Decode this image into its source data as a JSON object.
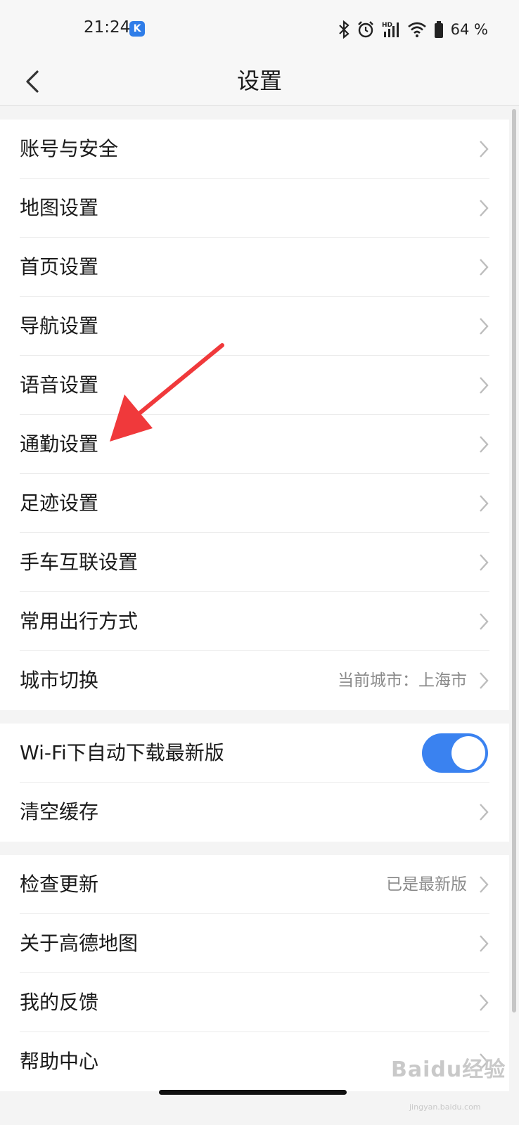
{
  "status_bar": {
    "time": "21:24",
    "app_icon_letter": "K",
    "battery": "64 %",
    "icons": [
      "bluetooth-icon",
      "alarm-icon",
      "hd-signal-icon",
      "wifi-icon",
      "battery-icon"
    ]
  },
  "header": {
    "title": "设置",
    "back_icon": "back-arrow-icon"
  },
  "groups": {
    "main": [
      {
        "label": "账号与安全"
      },
      {
        "label": "地图设置"
      },
      {
        "label": "首页设置"
      },
      {
        "label": "导航设置"
      },
      {
        "label": "语音设置"
      },
      {
        "label": "通勤设置"
      },
      {
        "label": "足迹设置"
      },
      {
        "label": "手车互联设置"
      },
      {
        "label": "常用出行方式"
      },
      {
        "label": "城市切换",
        "value": "当前城市：上海市"
      }
    ],
    "download": [
      {
        "label": "Wi-Fi下自动下载最新版",
        "toggle_on": true
      },
      {
        "label": "清空缓存"
      }
    ],
    "about": [
      {
        "label": "检查更新",
        "value": "已是最新版"
      },
      {
        "label": "关于高德地图"
      },
      {
        "label": "我的反馈"
      },
      {
        "label": "帮助中心"
      }
    ]
  },
  "annotation": {
    "color": "#f0393b",
    "icon": "red-arrow-annotation"
  },
  "watermark": {
    "text": "Baidu经验",
    "sub": "jingyan.baidu.com"
  }
}
